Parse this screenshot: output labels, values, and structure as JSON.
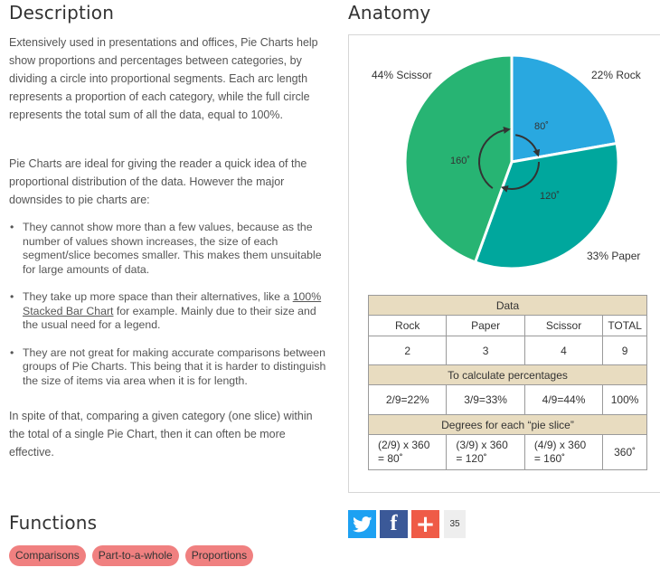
{
  "description": {
    "title": "Description",
    "p1": "Extensively used in presentations and offices, Pie Charts help show proportions and percentages between categories, by dividing a circle into proportional segments. Each arc length represents a proportion of each category, while the full circle represents the total sum of all the data, equal to 100%.",
    "p2": "Pie Charts are ideal for giving the reader a quick idea of the proportional distribution of the data. However the major downsides to pie charts are:",
    "bullets": [
      "They cannot show more than a few values, because as the number of values shown increases, the size of each segment/slice becomes smaller. This makes them unsuitable for large amounts of data.",
      {
        "before": "They take up more space than their alternatives, like a ",
        "link": "100% Stacked Bar Chart",
        "after": " for example. Mainly due to their size and the usual need for a legend."
      },
      "They are not great for making accurate comparisons between groups of Pie Charts. This being that it is harder to distinguish the size of items via area when it is for length."
    ],
    "p3": "In spite of that, comparing a given category (one slice) within the total of a single Pie Chart, then it can often be more effective."
  },
  "functions": {
    "title": "Functions",
    "tags": [
      "Comparisons",
      "Part-to-a-whole",
      "Proportions"
    ]
  },
  "anatomy": {
    "title": "Anatomy",
    "labels": {
      "scissor": "44% Scissor",
      "rock": "22% Rock",
      "paper": "33% Paper"
    },
    "angles": {
      "rock": "80˚",
      "paper": "120˚",
      "scissor": "160˚"
    },
    "colors": {
      "rock": "#29a8e0",
      "paper": "#00a79d",
      "scissor": "#27b473",
      "band": "#e8dcc0"
    },
    "table": {
      "data_title": "Data",
      "headers": [
        "Rock",
        "Paper",
        "Scissor",
        "TOTAL"
      ],
      "values": [
        "2",
        "3",
        "4",
        "9"
      ],
      "pct_title": "To calculate percentages",
      "pct": [
        "2/9=22%",
        "3/9=33%",
        "4/9=44%",
        "100%"
      ],
      "deg_title": "Degrees for each “pie slice”",
      "deg_line1": [
        "(2/9) x 360",
        "(3/9) x 360",
        "(4/9) x 360"
      ],
      "deg_line2": [
        "= 80˚",
        "= 120˚",
        "= 160˚"
      ],
      "deg_total": "360˚"
    }
  },
  "chart_data": {
    "type": "pie",
    "categories": [
      "Rock",
      "Paper",
      "Scissor"
    ],
    "values": [
      22,
      33,
      44
    ],
    "degrees": [
      80,
      120,
      160
    ],
    "colors": [
      "#29a8e0",
      "#00a79d",
      "#27b473"
    ]
  },
  "share": {
    "twitter_icon": "twitter-bird-icon",
    "facebook_glyph": "f",
    "plus_glyph": "+",
    "count": "35"
  }
}
